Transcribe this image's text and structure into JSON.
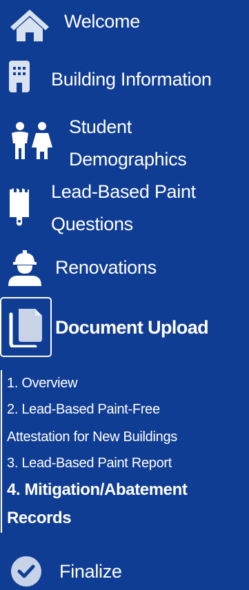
{
  "nav": {
    "items": [
      {
        "label": "Welcome",
        "icon": "home-icon"
      },
      {
        "label": "Building Information",
        "icon": "building-icon"
      },
      {
        "label_lines": [
          "Student",
          "Demographics"
        ],
        "icon": "students-icon"
      },
      {
        "label_lines": [
          "Lead-Based Paint",
          "Questions"
        ],
        "icon": "paint-brush-icon"
      },
      {
        "label": "Renovations",
        "icon": "worker-icon"
      },
      {
        "label": "Document Upload",
        "icon": "documents-icon",
        "active": true
      },
      {
        "label": "Finalize",
        "icon": "check-circle-icon"
      }
    ],
    "subitems": [
      {
        "label": "1. Overview"
      },
      {
        "label_lines": [
          "2. Lead-Based Paint-Free",
          "Attestation for New Buildings"
        ]
      },
      {
        "label": "3. Lead-Based Paint Report"
      },
      {
        "label_lines": [
          "4. Mitigation/Abatement",
          "Records"
        ],
        "current": true
      }
    ]
  },
  "colors": {
    "background": "#103d94",
    "foreground": "#ffffff",
    "icon_fill": "#d9e2f1",
    "check_fill": "#c8d3e8",
    "check_mark": "#103d94"
  }
}
